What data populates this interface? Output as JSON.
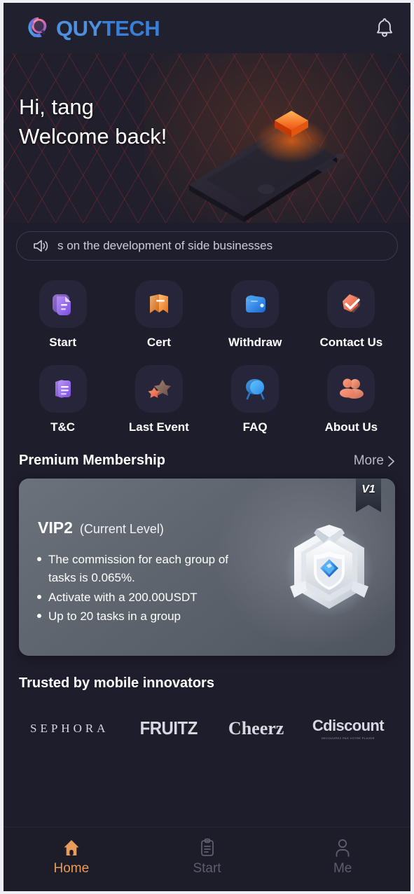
{
  "header": {
    "brand_primary": "QUY",
    "brand_secondary": "TECH",
    "logo_icon": "quytech-swirl-logo",
    "bell_icon": "bell-icon",
    "brand_color": "#4f8fe0"
  },
  "hero": {
    "greeting": "Hi, tang",
    "welcome": "Welcome back!",
    "illustration": "isometric-device-illustration",
    "accent_color": "#ff7a1a",
    "grid_color": "#c42c3c"
  },
  "announcement": {
    "icon": "speaker-announcement-icon",
    "text": "s on the development of side businesses"
  },
  "quick_actions": [
    {
      "label": "Start",
      "icon": "document-icon",
      "color": "#9b6cf0"
    },
    {
      "label": "Cert",
      "icon": "bookmark-ribbon-icon",
      "color": "#f59545"
    },
    {
      "label": "Withdraw",
      "icon": "wallet-icon",
      "color": "#2e86e0"
    },
    {
      "label": "Contact Us",
      "icon": "check-badge-icon",
      "color": "#ef7b62"
    },
    {
      "label": "T&C",
      "icon": "documents-stack-icon",
      "color": "#9b6cf0"
    },
    {
      "label": "Last Event",
      "icon": "stars-icon",
      "color": "#e87a55"
    },
    {
      "label": "FAQ",
      "icon": "chat-bubble-icon",
      "color": "#2e86e0"
    },
    {
      "label": "About Us",
      "icon": "users-icon",
      "color": "#ef8a6e"
    }
  ],
  "membership": {
    "section_title": "Premium Membership",
    "more_label": "More",
    "more_icon": "chevron-right-icon",
    "badge_ribbon": "V1",
    "level": "VIP2",
    "current_label": "(Current Level)",
    "medal_icon": "hexagon-shield-medal-icon",
    "benefits": [
      "The commission for each group of tasks is 0.065%.",
      "Activate with a 200.00USDT",
      "Up to 20 tasks in a group"
    ]
  },
  "trusted": {
    "title": "Trusted by mobile innovators",
    "brands": [
      {
        "name": "SEPHORA",
        "tagline": ""
      },
      {
        "name": "FRUITZ",
        "tagline": ""
      },
      {
        "name": "Cheerz",
        "tagline": ""
      },
      {
        "name": "Cdiscount",
        "tagline": "DECOUVREZ PAS VOTRE PLAISIR"
      }
    ]
  },
  "bottom_nav": {
    "active_color": "#e89b5a",
    "idle_color": "#5d5d6e",
    "items": [
      {
        "label": "Home",
        "icon": "home-icon",
        "active": true
      },
      {
        "label": "Start",
        "icon": "clipboard-icon",
        "active": false
      },
      {
        "label": "Me",
        "icon": "person-icon",
        "active": false
      }
    ]
  }
}
